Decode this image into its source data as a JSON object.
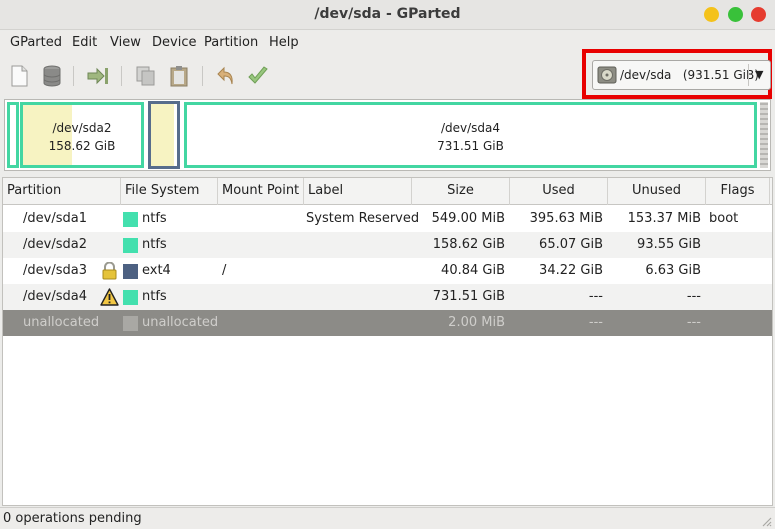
{
  "window": {
    "title": "/dev/sda - GParted"
  },
  "menu": [
    "GParted",
    "Edit",
    "View",
    "Device",
    "Partition",
    "Help"
  ],
  "toolbar": {
    "icons": [
      "new-partition-icon",
      "delete-partition-icon",
      "resize-move-icon",
      "copy-icon",
      "paste-icon",
      "undo-icon",
      "apply-icon"
    ]
  },
  "device": {
    "label": "/dev/sda   (931.51 GiB)"
  },
  "diskmap": {
    "sda2": {
      "name": "/dev/sda2",
      "size": "158.62 GiB"
    },
    "sda4": {
      "name": "/dev/sda4",
      "size": "731.51 GiB"
    }
  },
  "table": {
    "headers": [
      "Partition",
      "File System",
      "Mount Point",
      "Label",
      "Size",
      "Used",
      "Unused",
      "Flags"
    ],
    "rows": [
      {
        "partition": "/dev/sda1",
        "fs": "ntfs",
        "mount": "",
        "label": "System Reserved",
        "size": "549.00 MiB",
        "used": "395.63 MiB",
        "unused": "153.37 MiB",
        "flags": "boot",
        "icon": "",
        "color": "#43e0ae"
      },
      {
        "partition": "/dev/sda2",
        "fs": "ntfs",
        "mount": "",
        "label": "",
        "size": "158.62 GiB",
        "used": "65.07 GiB",
        "unused": "93.55 GiB",
        "flags": "",
        "icon": "",
        "color": "#43e0ae"
      },
      {
        "partition": "/dev/sda3",
        "fs": "ext4",
        "mount": "/",
        "label": "",
        "size": "40.84 GiB",
        "used": "34.22 GiB",
        "unused": "6.63 GiB",
        "flags": "",
        "icon": "lock-icon",
        "color": "#4d6182"
      },
      {
        "partition": "/dev/sda4",
        "fs": "ntfs",
        "mount": "",
        "label": "",
        "size": "731.51 GiB",
        "used": "---",
        "unused": "---",
        "flags": "",
        "icon": "warning-icon",
        "color": "#43e0ae"
      },
      {
        "partition": "unallocated",
        "fs": "unallocated",
        "mount": "",
        "label": "",
        "size": "2.00 MiB",
        "used": "---",
        "unused": "---",
        "flags": "",
        "icon": "",
        "color": "#a9a8a4"
      }
    ]
  },
  "status": {
    "text": "0 operations pending"
  },
  "colors": {
    "ntfs": "#43e0ae",
    "ext4": "#4d6182",
    "highlight": "#e80000",
    "used": "#f7f3c2"
  }
}
